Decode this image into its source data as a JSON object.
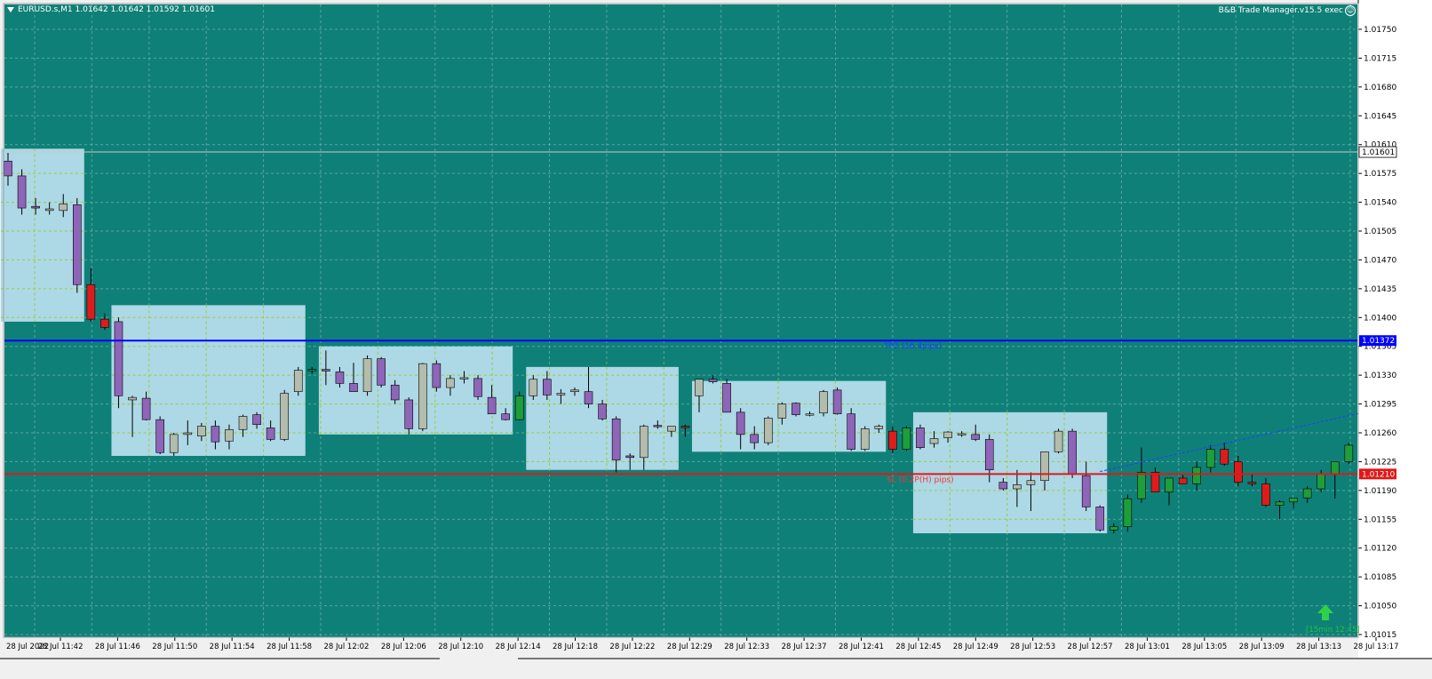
{
  "header": {
    "symbol_info": "EURUSD.s,M1  1.01642 1.01642 1.01592 1.01601",
    "ea_label": "B&B Trade Manager.v15.5 exec"
  },
  "colors": {
    "background": "#0f8078",
    "grid": "#8fc9c3",
    "box_fill": "#add8e6",
    "box_grid": "#9acd32",
    "bear_body": "#8e65b8",
    "bull_body_in_box": "#b4bcac",
    "bull_body_out": "#1e9e3a",
    "bear_body_out": "#dd1c1c",
    "tp_line": "#0000ff",
    "sl_line": "#e01818",
    "arrow": "#2fd04a"
  },
  "icons": [
    "dropdown-triangle-icon",
    "smiley-icon",
    "up-arrow-icon"
  ],
  "chart_data": {
    "type": "candlestick",
    "title": "EURUSD.s,M1",
    "ylim": [
      1.01,
      1.0178
    ],
    "y_ticks": [
      "1.01750",
      "1.01715",
      "1.01680",
      "1.01645",
      "1.01610",
      "1.01575",
      "1.01540",
      "1.01505",
      "1.01470",
      "1.01435",
      "1.01400",
      "1.01365",
      "1.01330",
      "1.01295",
      "1.01260",
      "1.01225",
      "1.01190",
      "1.01155",
      "1.01120",
      "1.01085",
      "1.01050",
      "1.01015"
    ],
    "x_ticks": [
      "28 Jul 2022",
      "28 Jul 11:42",
      "28 Jul 11:46",
      "28 Jul 11:50",
      "28 Jul 11:54",
      "28 Jul 11:58",
      "28 Jul 12:02",
      "28 Jul 12:06",
      "28 Jul 12:10",
      "28 Jul 12:14",
      "28 Jul 12:18",
      "28 Jul 12:22",
      "28 Jul 12:29",
      "28 Jul 12:33",
      "28 Jul 12:37",
      "28 Jul 12:41",
      "28 Jul 12:45",
      "28 Jul 12:49",
      "28 Jul 12:53",
      "28 Jul 12:57",
      "28 Jul 13:01",
      "28 Jul 13:05",
      "28 Jul 13:09",
      "28 Jul 13:13",
      "28 Jul 13:17"
    ],
    "current_price": "1.01601",
    "tp_line": {
      "price": 1.01372,
      "label": "TP2 (16.4pips)",
      "price_label": "1.01372"
    },
    "sl_line": {
      "price": 1.0121,
      "label": "SL (0.2P(H) pips)",
      "price_label": "1.01210"
    },
    "signal_label": "[15min 12:45]",
    "candles": [
      {
        "o": 1.0159,
        "h": 1.016,
        "l": 1.0156,
        "c": 1.01572
      },
      {
        "o": 1.01572,
        "h": 1.0158,
        "l": 1.01525,
        "c": 1.01533
      },
      {
        "o": 1.01535,
        "h": 1.01545,
        "l": 1.01525,
        "c": 1.01533
      },
      {
        "o": 1.0153,
        "h": 1.0154,
        "l": 1.01525,
        "c": 1.01532
      },
      {
        "o": 1.0153,
        "h": 1.0155,
        "l": 1.01522,
        "c": 1.01538
      },
      {
        "o": 1.01537,
        "h": 1.01545,
        "l": 1.0143,
        "c": 1.0144
      },
      {
        "o": 1.0144,
        "h": 1.0146,
        "l": 1.01395,
        "c": 1.01398
      },
      {
        "o": 1.01398,
        "h": 1.01405,
        "l": 1.01385,
        "c": 1.01388
      },
      {
        "o": 1.01395,
        "h": 1.014,
        "l": 1.0129,
        "c": 1.01305
      },
      {
        "o": 1.013,
        "h": 1.01305,
        "l": 1.01255,
        "c": 1.01303
      },
      {
        "o": 1.01302,
        "h": 1.0131,
        "l": 1.01275,
        "c": 1.01276
      },
      {
        "o": 1.01276,
        "h": 1.0128,
        "l": 1.01234,
        "c": 1.01236
      },
      {
        "o": 1.01236,
        "h": 1.0126,
        "l": 1.01232,
        "c": 1.01258
      },
      {
        "o": 1.01258,
        "h": 1.01275,
        "l": 1.01245,
        "c": 1.0126
      },
      {
        "o": 1.01256,
        "h": 1.01272,
        "l": 1.0125,
        "c": 1.01268
      },
      {
        "o": 1.01268,
        "h": 1.01275,
        "l": 1.0124,
        "c": 1.01249
      },
      {
        "o": 1.0125,
        "h": 1.0127,
        "l": 1.0124,
        "c": 1.01264
      },
      {
        "o": 1.01264,
        "h": 1.01282,
        "l": 1.01255,
        "c": 1.0128
      },
      {
        "o": 1.01282,
        "h": 1.01285,
        "l": 1.01265,
        "c": 1.0127
      },
      {
        "o": 1.01266,
        "h": 1.01275,
        "l": 1.0125,
        "c": 1.01252
      },
      {
        "o": 1.01252,
        "h": 1.01312,
        "l": 1.0125,
        "c": 1.01308
      },
      {
        "o": 1.0131,
        "h": 1.0134,
        "l": 1.01305,
        "c": 1.01336
      },
      {
        "o": 1.01336,
        "h": 1.0134,
        "l": 1.01332,
        "c": 1.01337
      },
      {
        "o": 1.01337,
        "h": 1.0136,
        "l": 1.01318,
        "c": 1.01335
      },
      {
        "o": 1.01334,
        "h": 1.0134,
        "l": 1.01315,
        "c": 1.0132
      },
      {
        "o": 1.0132,
        "h": 1.01345,
        "l": 1.0131,
        "c": 1.0131
      },
      {
        "o": 1.0131,
        "h": 1.01354,
        "l": 1.01305,
        "c": 1.0135
      },
      {
        "o": 1.0135,
        "h": 1.01352,
        "l": 1.01315,
        "c": 1.01318
      },
      {
        "o": 1.01318,
        "h": 1.01324,
        "l": 1.01295,
        "c": 1.013
      },
      {
        "o": 1.013,
        "h": 1.01303,
        "l": 1.01258,
        "c": 1.01265
      },
      {
        "o": 1.01265,
        "h": 1.01345,
        "l": 1.01262,
        "c": 1.01344
      },
      {
        "o": 1.01344,
        "h": 1.01348,
        "l": 1.0131,
        "c": 1.01315
      },
      {
        "o": 1.01315,
        "h": 1.0133,
        "l": 1.01305,
        "c": 1.01326
      },
      {
        "o": 1.01326,
        "h": 1.01335,
        "l": 1.0132,
        "c": 1.01327
      },
      {
        "o": 1.01326,
        "h": 1.0133,
        "l": 1.013,
        "c": 1.01304
      },
      {
        "o": 1.01303,
        "h": 1.01318,
        "l": 1.0129,
        "c": 1.01283
      },
      {
        "o": 1.01283,
        "h": 1.0129,
        "l": 1.01275,
        "c": 1.01276
      },
      {
        "o": 1.01276,
        "h": 1.0131,
        "l": 1.01275,
        "c": 1.01305
      },
      {
        "o": 1.01305,
        "h": 1.0133,
        "l": 1.013,
        "c": 1.01325
      },
      {
        "o": 1.01325,
        "h": 1.01335,
        "l": 1.013,
        "c": 1.01306
      },
      {
        "o": 1.01306,
        "h": 1.01313,
        "l": 1.01295,
        "c": 1.01308
      },
      {
        "o": 1.0131,
        "h": 1.01315,
        "l": 1.01305,
        "c": 1.01312
      },
      {
        "o": 1.0131,
        "h": 1.0134,
        "l": 1.0129,
        "c": 1.01295
      },
      {
        "o": 1.01295,
        "h": 1.013,
        "l": 1.01275,
        "c": 1.01277
      },
      {
        "o": 1.01277,
        "h": 1.0128,
        "l": 1.01212,
        "c": 1.01227
      },
      {
        "o": 1.01232,
        "h": 1.01235,
        "l": 1.01215,
        "c": 1.0123
      },
      {
        "o": 1.0123,
        "h": 1.0127,
        "l": 1.01215,
        "c": 1.01268
      },
      {
        "o": 1.01269,
        "h": 1.01275,
        "l": 1.01265,
        "c": 1.01268
      },
      {
        "o": 1.01262,
        "h": 1.01268,
        "l": 1.01255,
        "c": 1.01268
      },
      {
        "o": 1.01268,
        "h": 1.0127,
        "l": 1.01255,
        "c": 1.01267
      },
      {
        "o": 1.01305,
        "h": 1.01312,
        "l": 1.01285,
        "c": 1.01325
      },
      {
        "o": 1.01325,
        "h": 1.0133,
        "l": 1.0132,
        "c": 1.01322
      },
      {
        "o": 1.0132,
        "h": 1.01325,
        "l": 1.01285,
        "c": 1.01285
      },
      {
        "o": 1.01285,
        "h": 1.0129,
        "l": 1.0124,
        "c": 1.01258
      },
      {
        "o": 1.01258,
        "h": 1.01268,
        "l": 1.0124,
        "c": 1.01248
      },
      {
        "o": 1.01248,
        "h": 1.0128,
        "l": 1.01245,
        "c": 1.01278
      },
      {
        "o": 1.01278,
        "h": 1.01297,
        "l": 1.0127,
        "c": 1.01295
      },
      {
        "o": 1.01296,
        "h": 1.01297,
        "l": 1.0128,
        "c": 1.01282
      },
      {
        "o": 1.01282,
        "h": 1.01286,
        "l": 1.0128,
        "c": 1.01283
      },
      {
        "o": 1.01284,
        "h": 1.01312,
        "l": 1.0128,
        "c": 1.0131
      },
      {
        "o": 1.01312,
        "h": 1.01315,
        "l": 1.01282,
        "c": 1.01283
      },
      {
        "o": 1.01283,
        "h": 1.0129,
        "l": 1.01238,
        "c": 1.0124
      },
      {
        "o": 1.0124,
        "h": 1.01268,
        "l": 1.01238,
        "c": 1.01265
      },
      {
        "o": 1.01265,
        "h": 1.0127,
        "l": 1.0126,
        "c": 1.01268
      },
      {
        "o": 1.01262,
        "h": 1.01268,
        "l": 1.01235,
        "c": 1.0124
      },
      {
        "o": 1.0124,
        "h": 1.01268,
        "l": 1.01238,
        "c": 1.01266
      },
      {
        "o": 1.01266,
        "h": 1.0127,
        "l": 1.0124,
        "c": 1.01242
      },
      {
        "o": 1.01247,
        "h": 1.01262,
        "l": 1.01242,
        "c": 1.01253
      },
      {
        "o": 1.01254,
        "h": 1.01262,
        "l": 1.01248,
        "c": 1.01261
      },
      {
        "o": 1.01258,
        "h": 1.01262,
        "l": 1.01255,
        "c": 1.01259
      },
      {
        "o": 1.01258,
        "h": 1.0127,
        "l": 1.0125,
        "c": 1.01252
      },
      {
        "o": 1.01252,
        "h": 1.01258,
        "l": 1.012,
        "c": 1.01215
      },
      {
        "o": 1.012,
        "h": 1.01205,
        "l": 1.0119,
        "c": 1.01192
      },
      {
        "o": 1.01192,
        "h": 1.01215,
        "l": 1.0117,
        "c": 1.01197
      },
      {
        "o": 1.01197,
        "h": 1.01212,
        "l": 1.01165,
        "c": 1.01202
      },
      {
        "o": 1.01202,
        "h": 1.0123,
        "l": 1.0119,
        "c": 1.01237
      },
      {
        "o": 1.01237,
        "h": 1.01265,
        "l": 1.01235,
        "c": 1.01262
      },
      {
        "o": 1.01262,
        "h": 1.01265,
        "l": 1.01205,
        "c": 1.0121
      },
      {
        "o": 1.01208,
        "h": 1.01225,
        "l": 1.01165,
        "c": 1.0117
      },
      {
        "o": 1.0117,
        "h": 1.01172,
        "l": 1.0114,
        "c": 1.01142
      },
      {
        "o": 1.01142,
        "h": 1.0115,
        "l": 1.01138,
        "c": 1.01146
      },
      {
        "o": 1.01146,
        "h": 1.01185,
        "l": 1.0114,
        "c": 1.0118
      },
      {
        "o": 1.0118,
        "h": 1.01242,
        "l": 1.01175,
        "c": 1.01212
      },
      {
        "o": 1.01212,
        "h": 1.01218,
        "l": 1.0119,
        "c": 1.01188
      },
      {
        "o": 1.01188,
        "h": 1.01205,
        "l": 1.01172,
        "c": 1.01205
      },
      {
        "o": 1.01205,
        "h": 1.0121,
        "l": 1.012,
        "c": 1.01198
      },
      {
        "o": 1.01198,
        "h": 1.01225,
        "l": 1.0119,
        "c": 1.01218
      },
      {
        "o": 1.01218,
        "h": 1.01245,
        "l": 1.01212,
        "c": 1.0124
      },
      {
        "o": 1.0124,
        "h": 1.01248,
        "l": 1.0122,
        "c": 1.01222
      },
      {
        "o": 1.01225,
        "h": 1.01232,
        "l": 1.01195,
        "c": 1.012
      },
      {
        "o": 1.012,
        "h": 1.0121,
        "l": 1.01195,
        "c": 1.01198
      },
      {
        "o": 1.01198,
        "h": 1.01205,
        "l": 1.0117,
        "c": 1.01172
      },
      {
        "o": 1.01172,
        "h": 1.01178,
        "l": 1.01155,
        "c": 1.01176
      },
      {
        "o": 1.01176,
        "h": 1.0118,
        "l": 1.01168,
        "c": 1.01181
      },
      {
        "o": 1.01181,
        "h": 1.01195,
        "l": 1.01175,
        "c": 1.01192
      },
      {
        "o": 1.01192,
        "h": 1.01215,
        "l": 1.01188,
        "c": 1.0121
      },
      {
        "o": 1.0121,
        "h": 1.01225,
        "l": 1.0118,
        "c": 1.01225
      },
      {
        "o": 1.01225,
        "h": 1.01248,
        "l": 1.01222,
        "c": 1.01245
      },
      {
        "o": 1.01245,
        "h": 1.01275,
        "l": 1.0124,
        "c": 1.01273
      },
      {
        "o": 1.01273,
        "h": 1.01282,
        "l": 1.01252,
        "c": 1.0128
      },
      {
        "o": 1.0128,
        "h": 1.013,
        "l": 1.01275,
        "c": 1.01296
      }
    ],
    "boxes": [
      {
        "start": 0,
        "end": 5,
        "low": 1.01395,
        "high": 1.01605
      },
      {
        "start": 8,
        "end": 21,
        "low": 1.01232,
        "high": 1.01415
      },
      {
        "start": 23,
        "end": 36,
        "low": 1.01258,
        "high": 1.01365
      },
      {
        "start": 38,
        "end": 48,
        "low": 1.01215,
        "high": 1.0134
      },
      {
        "start": 50,
        "end": 63,
        "low": 1.01237,
        "high": 1.01323
      },
      {
        "start": 66,
        "end": 79,
        "low": 1.01138,
        "high": 1.01285
      }
    ],
    "trend_line": {
      "from_candle": 79,
      "from_price": 1.01213,
      "to_candle": 101,
      "to_price": 1.01296
    }
  }
}
